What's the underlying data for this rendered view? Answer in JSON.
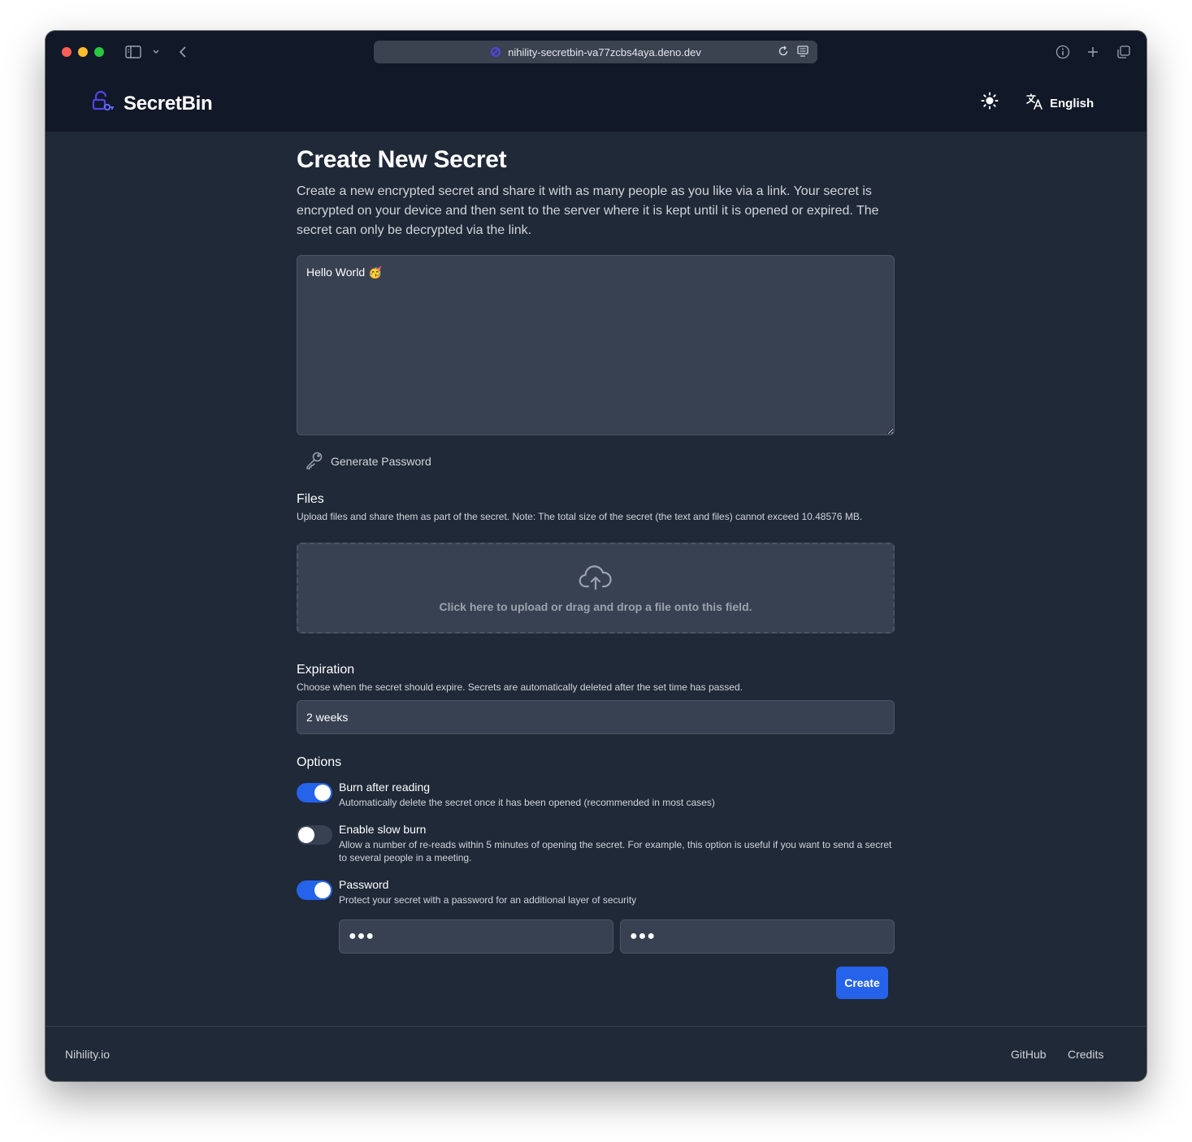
{
  "browser": {
    "url": "nihility-secretbin-va77zcbs4aya.deno.dev"
  },
  "navbar": {
    "brand": "SecretBin",
    "language": "English"
  },
  "main": {
    "title": "Create New Secret",
    "intro": "Create a new encrypted secret and share it with as many people as you like via a link. Your secret is encrypted on your device and then sent to the server where it is kept until it is opened or expired. The secret can only be decrypted via the link.",
    "secret_text": "Hello World 🥳",
    "generate_password": "Generate Password",
    "files": {
      "title": "Files",
      "description": "Upload files and share them as part of the secret. Note: The total size of the secret (the text and files) cannot exceed 10.48576 MB.",
      "dropzone_text": "Click here to upload or drag and drop a file onto this field."
    },
    "expiration": {
      "title": "Expiration",
      "description": "Choose when the secret should expire. Secrets are automatically deleted after the set time has passed.",
      "selected": "2 weeks"
    },
    "options": {
      "title": "Options",
      "items": [
        {
          "title": "Burn after reading",
          "description": "Automatically delete the secret once it has been opened (recommended in most cases)",
          "enabled": true
        },
        {
          "title": "Enable slow burn",
          "description": "Allow a number of re-reads within 5 minutes of opening the secret. For example, this option is useful if you want to send a secret to several people in a meeting.",
          "enabled": false
        },
        {
          "title": "Password",
          "description": "Protect your secret with a password for an additional layer of security",
          "enabled": true
        }
      ],
      "password_value": "●●●",
      "password_confirm_value": "●●●"
    },
    "create_label": "Create"
  },
  "footer": {
    "left": "Nihility.io",
    "links": [
      "GitHub",
      "Credits"
    ]
  },
  "colors": {
    "background": "#1f2937",
    "header": "#111827",
    "input": "#374151",
    "accent": "#2563eb"
  },
  "icons": {
    "brand": "lock-key-icon",
    "theme": "sun-icon",
    "language": "translate-icon",
    "generate": "key-icon",
    "upload": "cloud-upload-icon"
  }
}
